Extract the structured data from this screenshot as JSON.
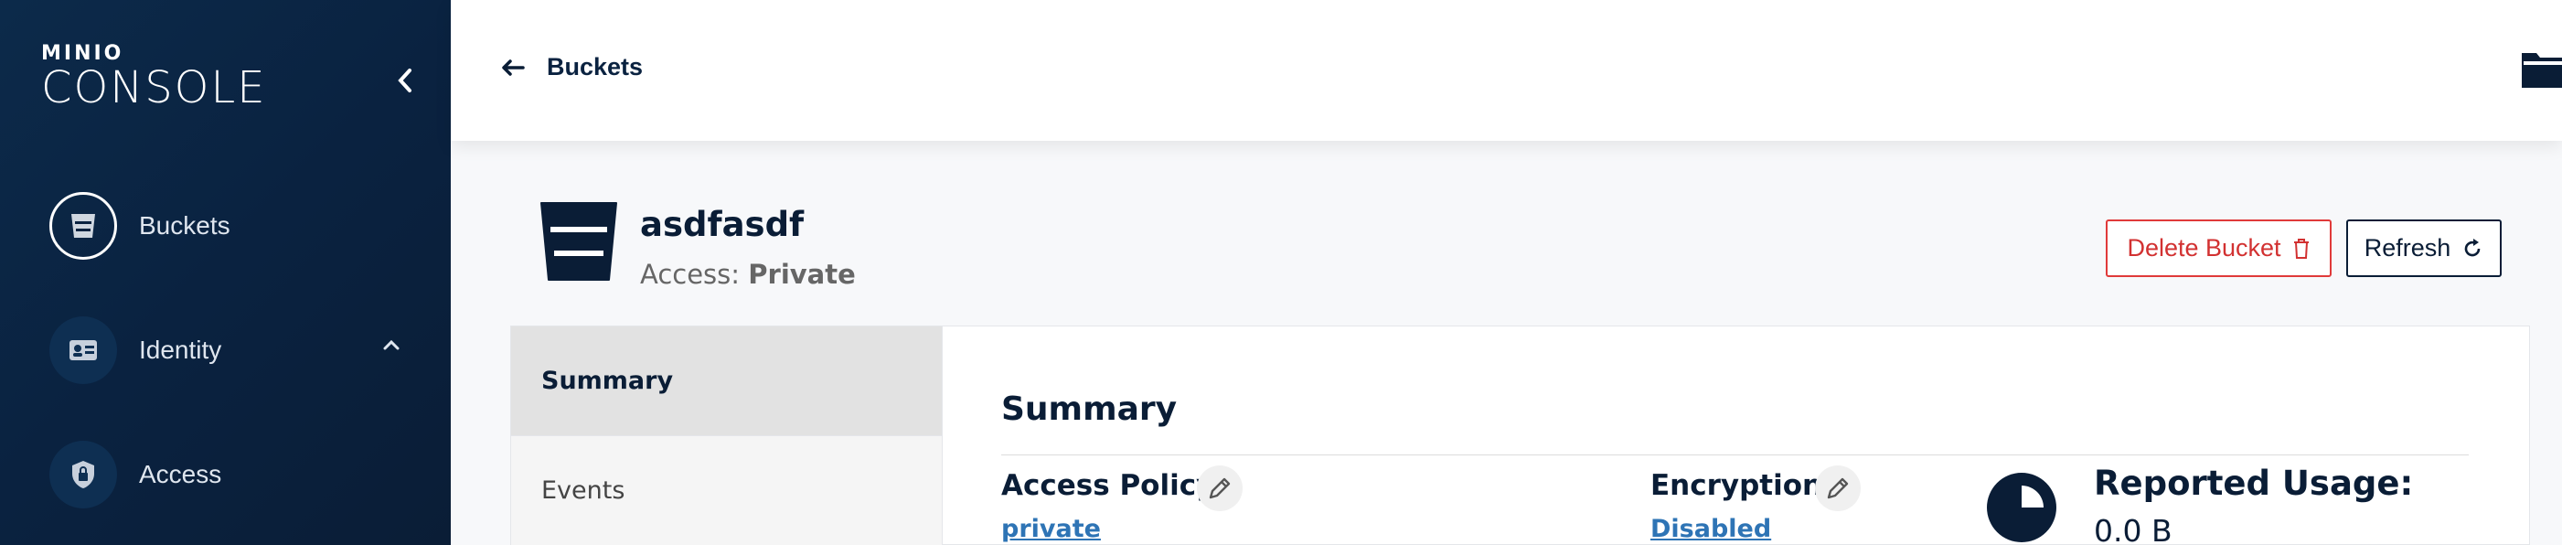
{
  "brand": {
    "top": "MINIO",
    "main": "CONSOLE"
  },
  "sidebar": {
    "items": [
      {
        "label": "Buckets",
        "icon": "bucket-icon"
      },
      {
        "label": "Identity",
        "icon": "id-card-icon"
      },
      {
        "label": "Access",
        "icon": "shield-lock-icon"
      }
    ]
  },
  "header": {
    "back_label": "Buckets"
  },
  "bucket": {
    "name": "asdfasdf",
    "access_prefix": "Access:",
    "access_value": "Private"
  },
  "actions": {
    "delete_label": "Delete Bucket",
    "refresh_label": "Refresh"
  },
  "tabs": [
    {
      "label": "Summary",
      "active": true
    },
    {
      "label": "Events",
      "active": false
    }
  ],
  "summary": {
    "title": "Summary",
    "access_policy_label": "Access Policy:",
    "access_policy_value": "private",
    "encryption_label": "Encryption:",
    "encryption_value": "Disabled",
    "usage_label": "Reported Usage:",
    "usage_value": "0.0 B"
  },
  "colors": {
    "sidebar_bg": "#0a2240",
    "primary": "#0a1d36",
    "danger": "#d23131",
    "link": "#2e74b5"
  }
}
